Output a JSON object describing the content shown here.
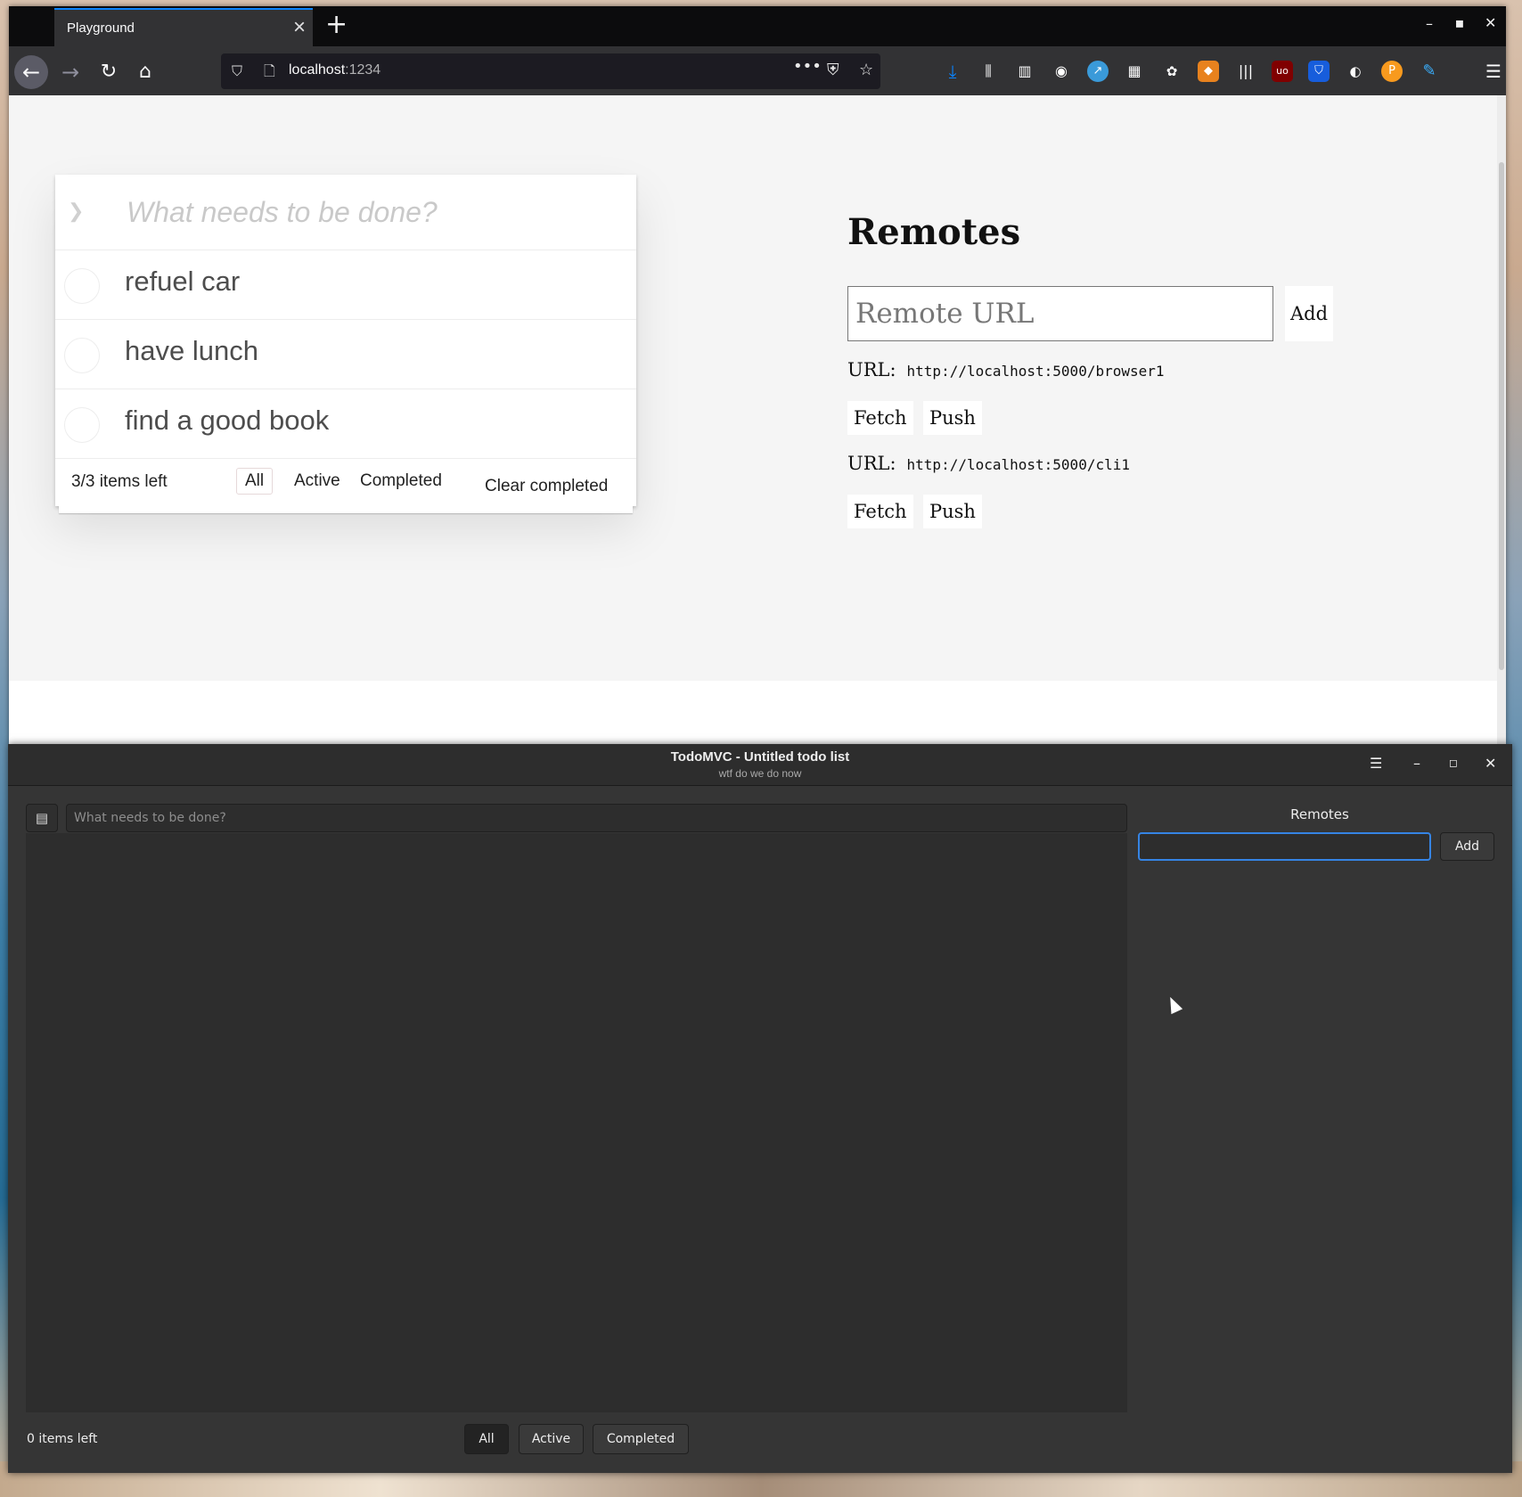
{
  "browser": {
    "tab_title": "Playground",
    "address_host": "localhost",
    "address_port": ":1234",
    "icons": [
      "back-icon",
      "forward-icon",
      "reload-icon",
      "home-icon",
      "shield-icon",
      "page-icon",
      "more-icon",
      "pocket-icon",
      "star-icon",
      "download-icon",
      "library-icon",
      "sidebar-icon",
      "account-icon"
    ]
  },
  "todomvc": {
    "new_placeholder": "What needs to be done?",
    "items": [
      "refuel car",
      "have lunch",
      "find a good book"
    ],
    "count": "3/3 items left",
    "filters": [
      "All",
      "Active",
      "Completed"
    ],
    "selected_filter": "All",
    "clear_label": "Clear completed"
  },
  "web_remotes": {
    "heading": "Remotes",
    "url_placeholder": "Remote URL",
    "add_label": "Add",
    "url_label": "URL:",
    "remotes": [
      {
        "url": "http://localhost:5000/browser1",
        "fetch": "Fetch",
        "push": "Push"
      },
      {
        "url": "http://localhost:5000/cli1",
        "fetch": "Fetch",
        "push": "Push"
      }
    ]
  },
  "gtk_app": {
    "title": "TodoMVC - Untitled todo list",
    "subtitle": "wtf do we do now",
    "entry_placeholder": "What needs to be done?",
    "remotes_title": "Remotes",
    "add_label": "Add",
    "count": "0 items left",
    "filters": [
      "All",
      "Active",
      "Completed"
    ],
    "selected_filter": "All"
  },
  "colors": {
    "accent": "#3584e4",
    "firefox_tab_accent": "#0a84ff"
  }
}
